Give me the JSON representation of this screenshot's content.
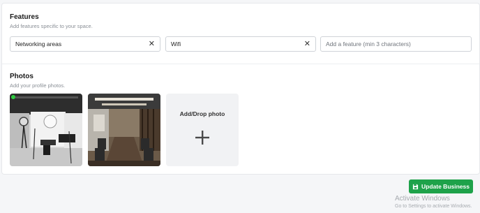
{
  "features": {
    "title": "Features",
    "subtitle": "Add features specific to your space.",
    "tags": [
      {
        "label": "Networking areas"
      },
      {
        "label": "Wifi"
      }
    ],
    "input_placeholder": "Add a feature (min 3 characters)"
  },
  "photos": {
    "title": "Photos",
    "subtitle": "Add your profile photos.",
    "items": [
      {
        "icon": "photo-studio-image",
        "primary_indicator_color": "#2ecc40"
      },
      {
        "icon": "conference-room-image"
      }
    ],
    "add_label": "Add/Drop photo",
    "add_icon": "plus-icon"
  },
  "actions": {
    "update_label": "Update Business",
    "update_icon": "save-icon",
    "accent_color": "#1ea24a"
  },
  "watermark": {
    "title": "Activate Windows",
    "subtitle": "Go to Settings to activate Windows."
  }
}
